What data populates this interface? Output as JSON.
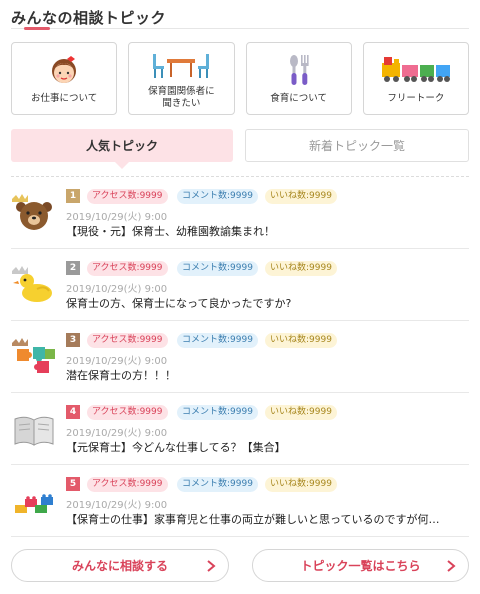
{
  "section": {
    "title": "みんなの相談トピック"
  },
  "categories": [
    {
      "label": "お仕事について",
      "icon": "girl-face-icon"
    },
    {
      "label": "保育園関係者に\n聞きたい",
      "icon": "table-chairs-icon"
    },
    {
      "label": "食育について",
      "icon": "spoon-fork-icon"
    },
    {
      "label": "フリートーク",
      "icon": "toy-train-icon"
    }
  ],
  "tabs": {
    "popular": "人気トピック",
    "new_list": "新着トピック一覧"
  },
  "topics": [
    {
      "rank": "1",
      "rank_color": "#c9a66b",
      "access": "アクセス数:9999",
      "comments": "コメント数:9999",
      "likes": "いいね数:9999",
      "date": "2019/10/29(火) 9:00",
      "title": "【現役・元】保育士、幼稚園教諭集まれ！",
      "icon": "bear-icon"
    },
    {
      "rank": "2",
      "rank_color": "#9a9a9a",
      "access": "アクセス数:9999",
      "comments": "コメント数:9999",
      "likes": "いいね数:9999",
      "date": "2019/10/29(火) 9:00",
      "title": "保育士の方、保育士になって良かったですか?",
      "icon": "duck-icon"
    },
    {
      "rank": "3",
      "rank_color": "#a57b5a",
      "access": "アクセス数:9999",
      "comments": "コメント数:9999",
      "likes": "いいね数:9999",
      "date": "2019/10/29(火) 9:00",
      "title": "潜在保育士の方！！！",
      "icon": "puzzle-icon"
    },
    {
      "rank": "4",
      "rank_color": "#e35a6a",
      "access": "アクセス数:9999",
      "comments": "コメント数:9999",
      "likes": "いいね数:9999",
      "date": "2019/10/29(火) 9:00",
      "title": "【元保育士】今どんな仕事してる？【集合】",
      "icon": "book-icon"
    },
    {
      "rank": "5",
      "rank_color": "#e35a6a",
      "access": "アクセス数:9999",
      "comments": "コメント数:9999",
      "likes": "いいね数:9999",
      "date": "2019/10/29(火) 9:00",
      "title": "【保育士の仕事】家事育児と仕事の両立が難しいと思っているのですが何…",
      "icon": "blocks-icon"
    }
  ],
  "buttons": {
    "consult": "みんなに相談する",
    "topic_list": "トピック一覧はこちら"
  },
  "colors": {
    "accent": "#e35a6a",
    "access_bg": "#fde2e6",
    "comment_bg": "#e2f1fb",
    "like_bg": "#fdf4d6"
  }
}
